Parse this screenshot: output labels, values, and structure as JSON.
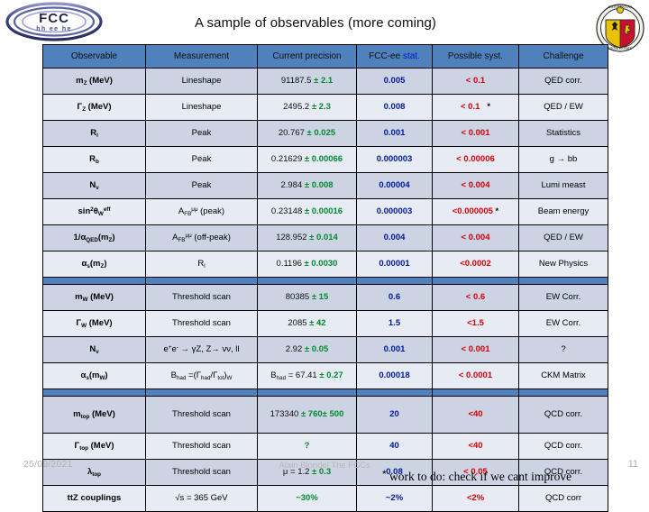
{
  "slide": {
    "title": "A sample of observables (more coming)",
    "logo_left": "fcc-logo",
    "logo_right": "university-of-geneva-seal"
  },
  "table": {
    "headers": [
      {
        "text": "Observable"
      },
      {
        "text": "Measurement"
      },
      {
        "text": "Current precision"
      },
      {
        "text": "FCC-ee ",
        "accent": "stat.",
        "accent_color": "#0018c8"
      },
      {
        "text": "Possible syst.",
        "color": "#e8000d"
      },
      {
        "text": "Challenge"
      }
    ],
    "header_bg": "#4f81bd",
    "band_a": "#ccd4e4",
    "band_b": "#e6ebf4",
    "rows": [
      {
        "observable": "m_Z (MeV)",
        "measurement": "Lineshape",
        "current": "91187.5",
        "current_err": "± 2.1",
        "stat": "0.005",
        "syst": "< 0.1",
        "syst_star": false,
        "challenge": "QED corr."
      },
      {
        "observable": "Γ_Z (MeV)",
        "measurement": "Lineshape",
        "current": "2495.2",
        "current_err": "± 2.3",
        "stat": "0.008",
        "syst": "< 0.1",
        "syst_star": true,
        "challenge": "QED / EW"
      },
      {
        "observable": "R_l",
        "measurement": "Peak",
        "current": "20.767",
        "current_err": "± 0.025",
        "stat": "0.001",
        "syst": "< 0.001",
        "syst_star": false,
        "challenge": "Statistics"
      },
      {
        "observable": "R_b",
        "measurement": "Peak",
        "current": "0.21629",
        "current_err": "± 0.00066",
        "stat": "0.000003",
        "syst": "< 0.00006",
        "syst_star": false,
        "challenge": "g → bb"
      },
      {
        "observable": "N_ν",
        "measurement": "Peak",
        "current": "2.984",
        "current_err": "± 0.008",
        "stat": "0.00004",
        "syst": "< 0.004",
        "syst_star": false,
        "challenge": "Lumi meast"
      },
      {
        "observable": "sin²θ_W eff",
        "measurement": "A_FB μμ (peak)",
        "current": "0.23148",
        "current_err": "± 0.00016",
        "stat": "0.000003",
        "syst": "<0.000005",
        "syst_star": true,
        "challenge": "Beam energy"
      },
      {
        "observable": "1/α_QED(m_Z)",
        "measurement": "A_FB μμ (off-peak)",
        "current": "128.952",
        "current_err": "± 0.014",
        "stat": "0.004",
        "syst": "< 0.004",
        "syst_star": false,
        "challenge": "QED / EW"
      },
      {
        "observable": "α_s(m_Z)",
        "measurement": "R_l",
        "current": "0.1196",
        "current_err": "± 0.0030",
        "stat": "0.00001",
        "syst": "<0.0002",
        "syst_star": false,
        "challenge": "New Physics"
      },
      {
        "separator": true
      },
      {
        "observable": "m_W (MeV)",
        "measurement": "Threshold scan",
        "current": "80385",
        "current_err": "± 15",
        "stat": "0.6",
        "syst": "< 0.6",
        "syst_star": false,
        "challenge": "EW Corr."
      },
      {
        "observable": "Γ_W (MeV)",
        "measurement": "Threshold scan",
        "current": "2085",
        "current_err": "± 42",
        "stat": "1.5",
        "syst": "<1.5",
        "syst_star": false,
        "challenge": "EW Corr."
      },
      {
        "observable": "N_ν",
        "measurement": "e+e- → γZ, Z→ νν, ll",
        "current": "2.92",
        "current_err": "± 0.05",
        "stat": "0.001",
        "syst": "< 0.001",
        "syst_star": false,
        "challenge": "?"
      },
      {
        "observable": "α_s(m_W)",
        "measurement": "B_had =(Γ_had/Γ_tot)_W",
        "current": "B_had = 67.41",
        "current_err": "± 0.27",
        "stat": "0.00018",
        "syst": "< 0.0001",
        "syst_star": false,
        "challenge": "CKM Matrix"
      },
      {
        "separator": true
      },
      {
        "observable": "m_top (MeV)",
        "measurement": "Threshold scan",
        "current": "173340",
        "current_err": "± 760± 500",
        "stat": "20",
        "syst": "<40",
        "syst_star": false,
        "challenge": "QCD corr."
      },
      {
        "observable": "Γ_top (MeV)",
        "measurement": "Threshold scan",
        "current": "",
        "current_err": "?",
        "stat": "40",
        "syst": "<40",
        "syst_star": false,
        "challenge": "QCD corr."
      },
      {
        "observable": "λ_top",
        "measurement": "Threshold scan",
        "current": "μ = 1.2",
        "current_err": "± 0.3",
        "stat": "0.08",
        "syst": "< 0.05",
        "syst_star": false,
        "challenge": "QCD corr."
      },
      {
        "observable": "ttZ couplings",
        "measurement": "√s = 365 GeV",
        "current": "",
        "current_err": "~30%",
        "stat": "~2%",
        "syst": "<2%",
        "syst_star": false,
        "challenge": "QCD corr"
      }
    ]
  },
  "footer": {
    "date": "25/09/2021",
    "center": "Alain Blondel The FCCs",
    "page": "11",
    "note": "work to do: check if we cant improve",
    "note_star": "*"
  }
}
